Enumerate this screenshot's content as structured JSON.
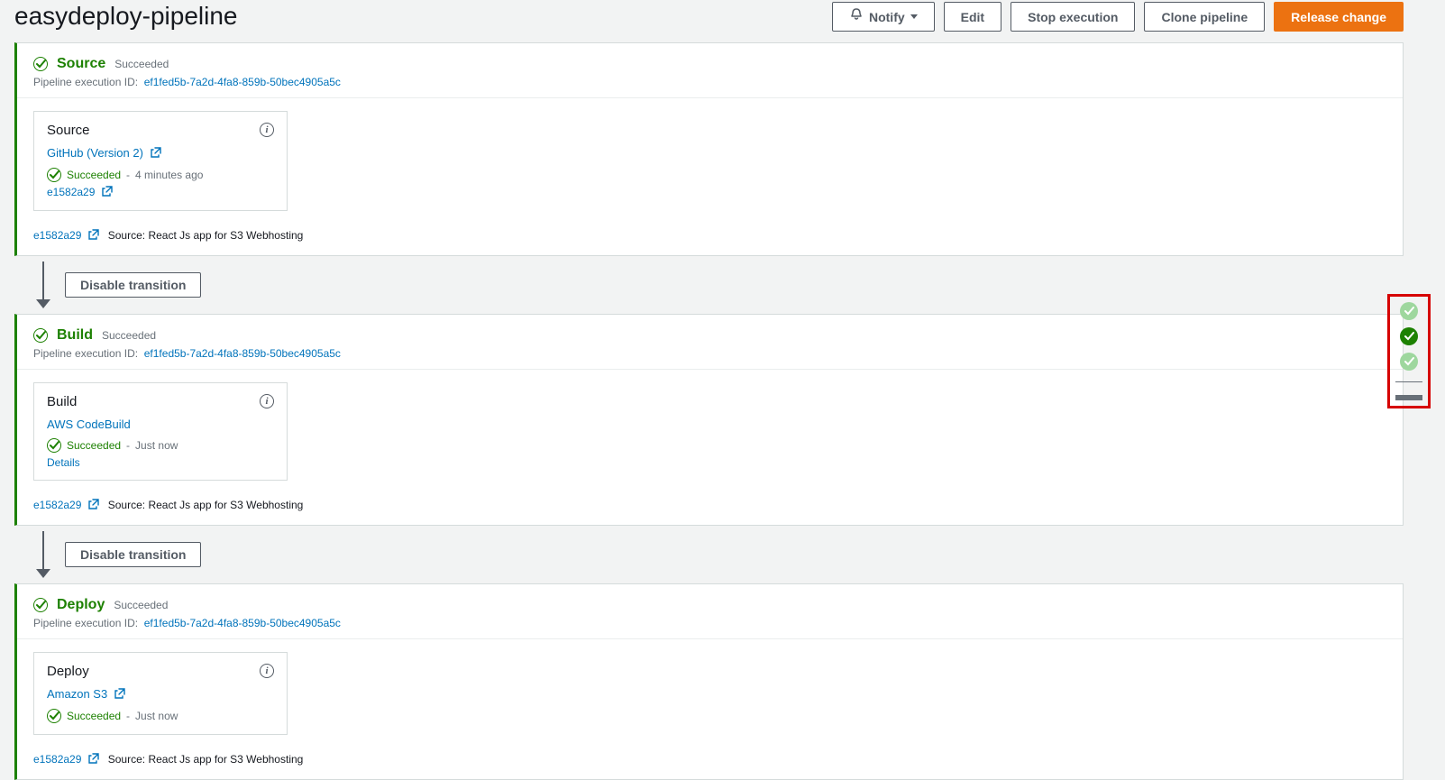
{
  "header": {
    "title": "easydeploy-pipeline",
    "buttons": {
      "notify": "Notify",
      "edit": "Edit",
      "stop": "Stop execution",
      "clone": "Clone pipeline",
      "release": "Release change"
    }
  },
  "labels": {
    "exec_id_prefix": "Pipeline execution ID:",
    "disable_transition": "Disable transition",
    "source_prefix": "Source:"
  },
  "stages": {
    "source": {
      "title": "Source",
      "status": "Succeeded",
      "exec_id": "ef1fed5b-7a2d-4fa8-859b-50bec4905a5c",
      "action": {
        "name": "Source",
        "provider": "GitHub (Version 2)",
        "status": "Succeeded",
        "time": "4 minutes ago",
        "commit_short": "e1582a29"
      },
      "footer": {
        "commit_short": "e1582a29",
        "msg": "React Js app for S3 Webhosting"
      }
    },
    "build": {
      "title": "Build",
      "status": "Succeeded",
      "exec_id": "ef1fed5b-7a2d-4fa8-859b-50bec4905a5c",
      "action": {
        "name": "Build",
        "provider": "AWS CodeBuild",
        "status": "Succeeded",
        "time": "Just now",
        "details": "Details"
      },
      "footer": {
        "commit_short": "e1582a29",
        "msg": "React Js app for S3 Webhosting"
      }
    },
    "deploy": {
      "title": "Deploy",
      "status": "Succeeded",
      "exec_id": "ef1fed5b-7a2d-4fa8-859b-50bec4905a5c",
      "action": {
        "name": "Deploy",
        "provider": "Amazon S3",
        "status": "Succeeded",
        "time": "Just now"
      },
      "footer": {
        "commit_short": "e1582a29",
        "msg": "React Js app for S3 Webhosting"
      }
    }
  }
}
